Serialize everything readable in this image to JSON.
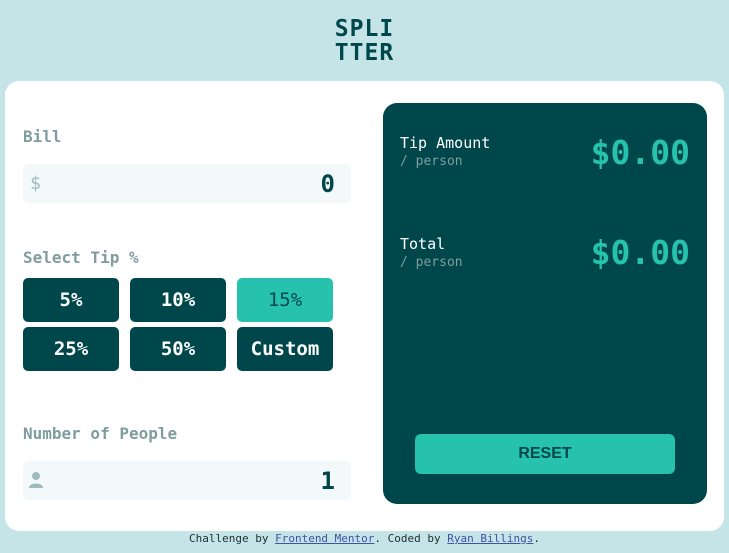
{
  "header": {
    "logo_line1": "SPLI",
    "logo_line2": "TTER"
  },
  "form": {
    "bill_label": "Bill",
    "bill_icon": "dollar-icon",
    "bill_symbol": "$",
    "bill_value": "0",
    "tip_label": "Select Tip %",
    "tips": [
      "5%",
      "10%",
      "15%",
      "25%",
      "50%",
      "Custom"
    ],
    "active_tip": "15%",
    "people_label": "Number of People",
    "people_icon": "person-icon",
    "people_value": "1"
  },
  "results": {
    "tip_title": "Tip Amount",
    "tip_sub": "/ person",
    "tip_value": "$0.00",
    "total_title": "Total",
    "total_sub": "/ person",
    "total_value": "$0.00",
    "reset_label": "RESET"
  },
  "footer": {
    "prefix": "Challenge by ",
    "link1": "Frontend Mentor",
    "middle": ". Coded by ",
    "link2": "Ryan Billings",
    "suffix": "."
  },
  "colors": {
    "background": "#c5e4e7",
    "dark_cyan": "#00474b",
    "strong_cyan": "#26c2ad",
    "grayish_cyan": "#7f9c9f",
    "input_bg": "#f3f9fa"
  }
}
